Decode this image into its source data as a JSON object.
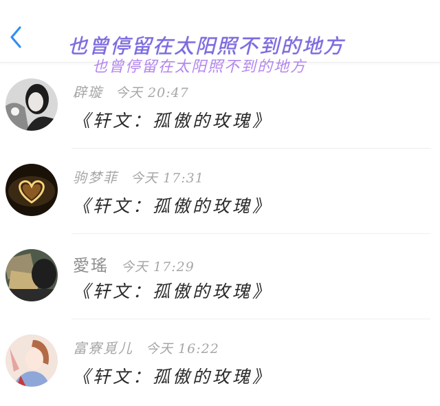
{
  "header": {
    "title": "也曾停留在太阳照不到的地方",
    "subtitle": "也曾停留在太阳照不到的地方"
  },
  "messages": [
    {
      "name": "辟璇",
      "time": "今天 20:47",
      "text": "《轩文：孤傲的玫瑰》",
      "avatar": "woman-portrait-bw"
    },
    {
      "name": "驹梦菲",
      "time": "今天 17:31",
      "text": "《轩文：孤傲的玫瑰》",
      "avatar": "candle-heart"
    },
    {
      "name": "愛瑤",
      "time": "今天 17:29",
      "text": "《轩文：孤傲的玫瑰》",
      "avatar": "money-photo"
    },
    {
      "name": "富寮覓儿",
      "time": "今天 16:22",
      "text": "《轩文：孤傲的玫瑰》",
      "avatar": "anime-girl"
    }
  ]
}
